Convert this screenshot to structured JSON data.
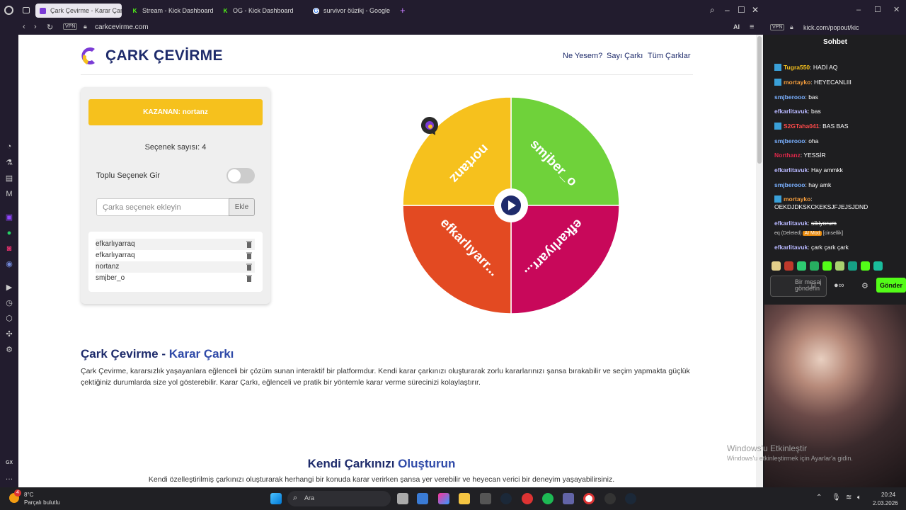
{
  "browser": {
    "tabs": [
      {
        "label": "Çark Çevirme - Karar Çarkı"
      },
      {
        "label": "Stream - Kick Dashboard"
      },
      {
        "label": "OG - Kick Dashboard"
      },
      {
        "label": "survivor öüzikj - Google"
      }
    ],
    "url": "carkcevirme.com",
    "vpn": "VPN",
    "ai": "AI"
  },
  "site": {
    "brand": "ÇARK ÇEVİRME",
    "nav": [
      "Ne Yesem?",
      "Sayı Çarkı",
      "Tüm Çarklar"
    ]
  },
  "panel": {
    "winner": "KAZANAN: nortanz",
    "count": "Seçenek sayısı: 4",
    "bulk_label": "Toplu Seçenek Gir",
    "input_placeholder": "Çarka seçenek ekleyin",
    "add_label": "Ekle",
    "options": [
      "efkarlıyarraq",
      "efkarlıyarraq",
      "nortanz",
      "smjber_o"
    ]
  },
  "wheel": {
    "segments": [
      {
        "label": "smjber_o",
        "color": "#6fd23a"
      },
      {
        "label": "efkarlıyarr...",
        "color": "#c8085a"
      },
      {
        "label": "efkarlıyarr...",
        "color": "#e34a22"
      },
      {
        "label": "nortanz",
        "color": "#f6c11d"
      }
    ]
  },
  "content": {
    "h1_a": "Çark Çevirme - ",
    "h1_b": "Karar Çarkı",
    "p1": "Çark Çevirme, kararsızlık yaşayanlara eğlenceli bir çözüm sunan interaktif bir platformdur. Kendi karar çarkınızı oluşturarak zorlu kararlarınızı şansa bırakabilir ve seçim yapmakta güçlük çektiğiniz durumlarda size yol gösterebilir. Karar Çarkı, eğlenceli ve pratik bir yöntemle karar verme sürecinizi kolaylaştırır.",
    "h2_a": "Kendi Çarkınızı ",
    "h2_b": "Oluşturun",
    "p2": "Kendi özelleştirilmiş çarkınızı oluşturarak herhangi bir konuda karar verirken şansa yer verebilir ve heyecan verici bir deneyim yaşayabilirsiniz."
  },
  "chat": {
    "url": "kick.com/popout/kic",
    "title": "Sohbet",
    "messages": [
      {
        "user": "Tugra550",
        "text": "HADİ AQ",
        "color": "#f6c11d",
        "badge": true
      },
      {
        "user": "mortayko",
        "text": "HEYECANLIII",
        "color": "#f39c3c",
        "badge": true
      },
      {
        "user": "smjberooo",
        "text": "bas",
        "color": "#7ab0ff",
        "badge": false
      },
      {
        "user": "efkarlitavuk",
        "text": "bas",
        "color": "#b8b8ff",
        "badge": false
      },
      {
        "user": "S2GTaha041",
        "text": "BAS BAS",
        "color": "#ff4a4a",
        "badge": true
      },
      {
        "user": "smjberooo",
        "text": "oha",
        "color": "#7ab0ff",
        "badge": false
      },
      {
        "user": "Northanz",
        "text": "YESSİR",
        "color": "#e0284a",
        "badge": false
      },
      {
        "user": "efkarlitavuk",
        "text": "Hay ammkk",
        "color": "#b8b8ff",
        "badge": false
      },
      {
        "user": "smjberooo",
        "text": "hay amk",
        "color": "#7ab0ff",
        "badge": false
      },
      {
        "user": "mortayko",
        "text": "OEKDJDKSKCKEKSJFJEJSJDND",
        "color": "#f39c3c",
        "badge": true
      },
      {
        "user": "efkarlitavuk",
        "text": "sikiyorum",
        "color": "#b8b8ff",
        "badge": false
      },
      {
        "user": "efkarlitavuk",
        "text": "çark çark çark",
        "color": "#b8b8ff",
        "badge": false
      }
    ],
    "deleted_note": "eq (Deleted)",
    "ai_mod": "AI Mod",
    "ai_reason": "[cinsellik]",
    "input_placeholder": "Bir mesaj gönderin",
    "send": "Gönder"
  },
  "windows": {
    "activate_1": "Windows'u Etkinleştir",
    "activate_2": "Windows'u etkinleştirmek için Ayarlar'a gidin.",
    "weather_temp": "8°C",
    "weather_desc": "Parçalı bulutlu",
    "search": "Ara",
    "notif_count": "4",
    "time": "20:24",
    "date": "2.03.2026",
    "gx": "GX"
  }
}
